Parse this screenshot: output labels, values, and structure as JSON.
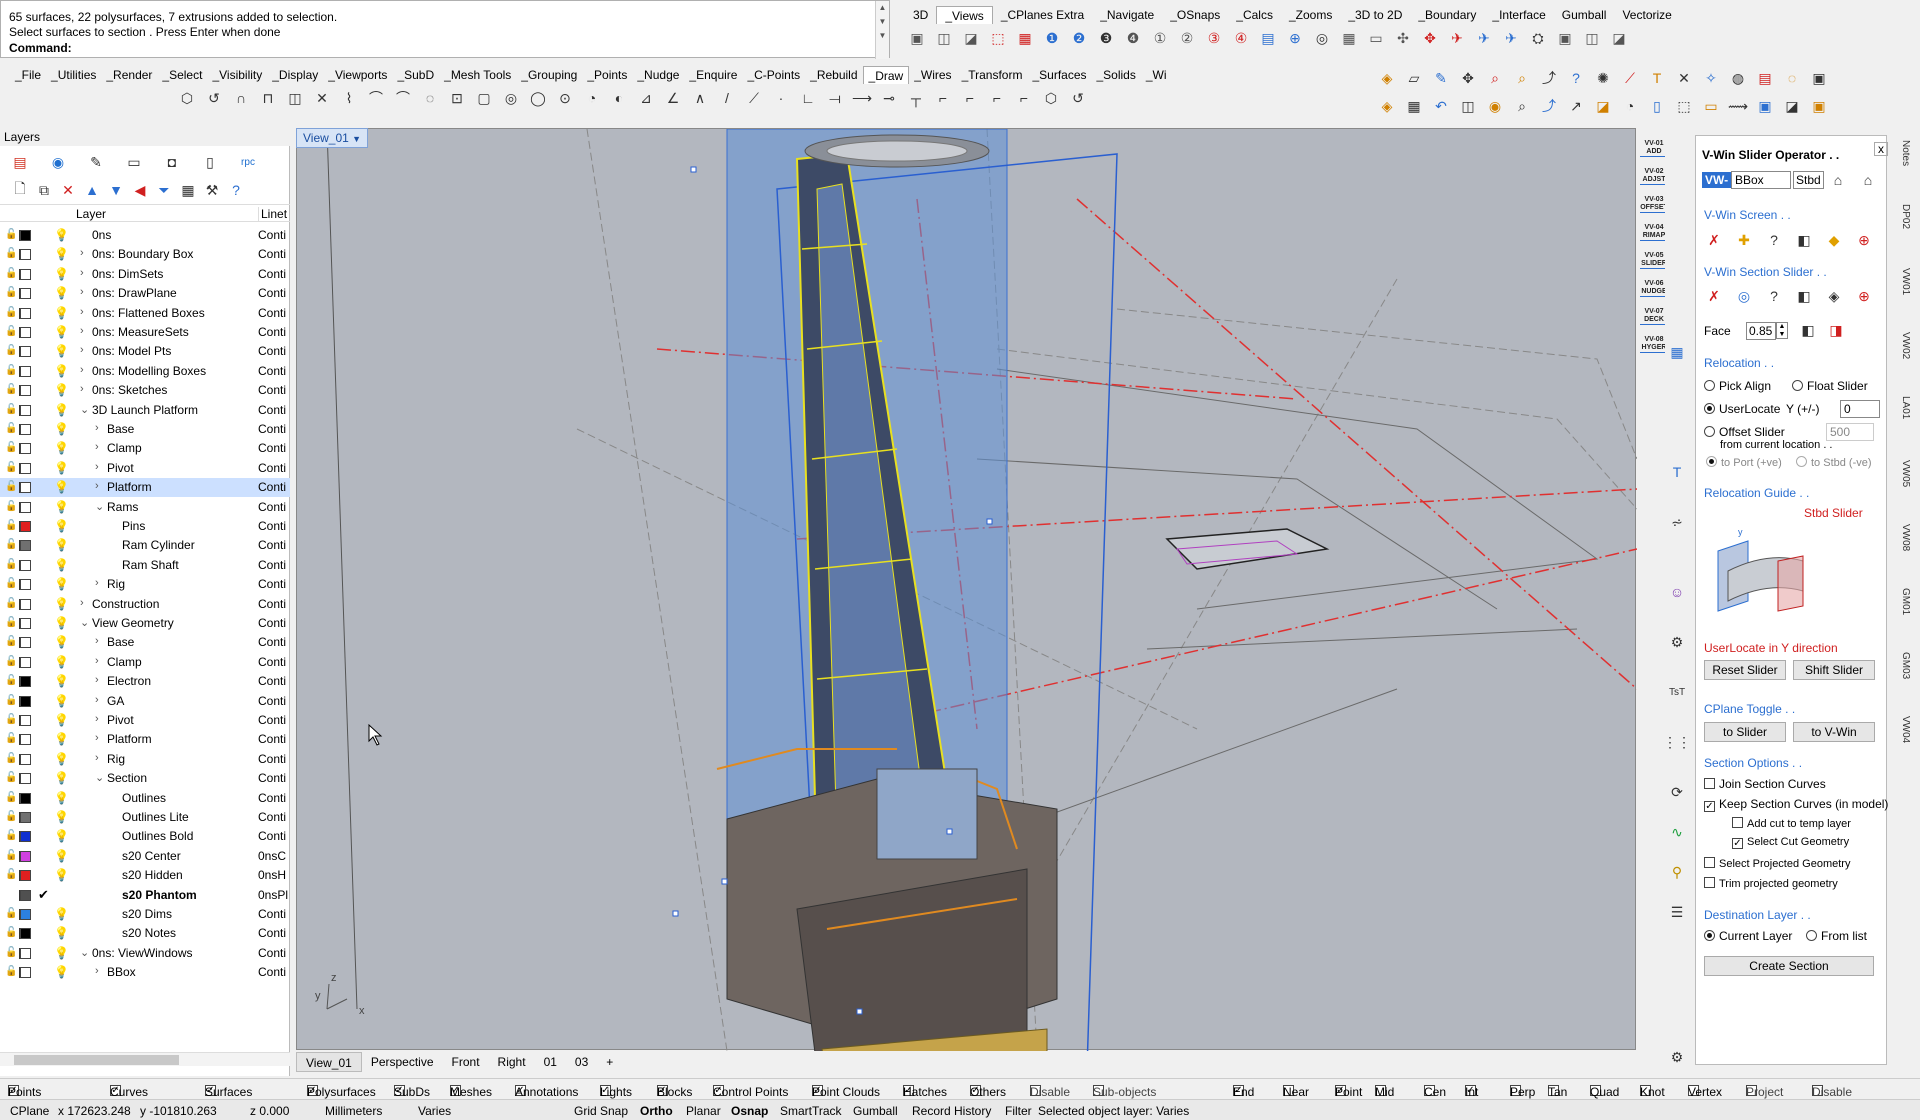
{
  "command": {
    "line1": "65 surfaces, 22 polysurfaces, 7 extrusions added to selection.",
    "line2": "Select surfaces to section . Press Enter when done",
    "prompt": "Command:"
  },
  "top_tabs": [
    "3D",
    "_Views",
    "_CPlanes Extra",
    "_Navigate",
    "_OSnaps",
    "_Calcs",
    "_Zooms",
    "_3D to 2D",
    "_Boundary",
    "_Interface",
    "Gumball",
    "Vectorize"
  ],
  "main_tabs": [
    "_File",
    "_Utilities",
    "_Render",
    "_Select",
    "_Visibility",
    "_Display",
    "_Viewports",
    "_SubD",
    "_Mesh Tools",
    "_Grouping",
    "_Points",
    "_Nudge",
    "_Enquire",
    "_C-Points",
    "_Rebuild",
    "_Draw",
    "_Wires",
    "_Transform",
    "_Surfaces",
    "_Solids",
    "_Wi"
  ],
  "layers_panel": {
    "title": "Layers",
    "col_layer": "Layer",
    "col_linetype": "Linet",
    "rows": [
      {
        "name": "0ns",
        "indent": 0,
        "arrow": "",
        "color": "#000000",
        "lt": "Conti",
        "bulb": "y"
      },
      {
        "name": "0ns: Boundary Box",
        "indent": 0,
        "arrow": ">",
        "color": "#ffffff",
        "lt": "Conti",
        "bulb": "y"
      },
      {
        "name": "0ns: DimSets",
        "indent": 0,
        "arrow": ">",
        "color": "#ffffff",
        "lt": "Conti",
        "bulb": "b"
      },
      {
        "name": "0ns: DrawPlane",
        "indent": 0,
        "arrow": ">",
        "color": "#ffffff",
        "lt": "Conti",
        "bulb": "y"
      },
      {
        "name": "0ns: Flattened Boxes",
        "indent": 0,
        "arrow": ">",
        "color": "#ffffff",
        "lt": "Conti",
        "bulb": "y"
      },
      {
        "name": "0ns: MeasureSets",
        "indent": 0,
        "arrow": ">",
        "color": "#ffffff",
        "lt": "Conti",
        "bulb": "y"
      },
      {
        "name": "0ns: Model Pts",
        "indent": 0,
        "arrow": ">",
        "color": "#ffffff",
        "lt": "Conti",
        "bulb": "y"
      },
      {
        "name": "0ns: Modelling Boxes",
        "indent": 0,
        "arrow": ">",
        "color": "#ffffff",
        "lt": "Conti",
        "bulb": "b"
      },
      {
        "name": "0ns: Sketches",
        "indent": 0,
        "arrow": ">",
        "color": "#ffffff",
        "lt": "Conti",
        "bulb": "y"
      },
      {
        "name": "3D Launch Platform",
        "indent": 0,
        "arrow": "v",
        "color": "#ffffff",
        "lt": "Conti",
        "bulb": "y"
      },
      {
        "name": "Base",
        "indent": 1,
        "arrow": ">",
        "color": "#ffffff",
        "lt": "Conti",
        "bulb": "y"
      },
      {
        "name": "Clamp",
        "indent": 1,
        "arrow": ">",
        "color": "#ffffff",
        "lt": "Conti",
        "bulb": "y"
      },
      {
        "name": "Pivot",
        "indent": 1,
        "arrow": ">",
        "color": "#ffffff",
        "lt": "Conti",
        "bulb": "y"
      },
      {
        "name": "Platform",
        "indent": 1,
        "arrow": ">",
        "color": "#ffffff",
        "lt": "Conti",
        "bulb": "y",
        "sel": true
      },
      {
        "name": "Rams",
        "indent": 1,
        "arrow": "v",
        "color": "#ffffff",
        "lt": "Conti",
        "bulb": "y"
      },
      {
        "name": "Pins",
        "indent": 2,
        "arrow": "",
        "color": "#e02020",
        "lt": "Conti",
        "bulb": "y"
      },
      {
        "name": "Ram Cylinder",
        "indent": 2,
        "arrow": "",
        "color": "#707070",
        "lt": "Conti",
        "bulb": "y"
      },
      {
        "name": "Ram Shaft",
        "indent": 2,
        "arrow": "",
        "color": "#ffffff",
        "lt": "Conti",
        "bulb": "y"
      },
      {
        "name": "Rig",
        "indent": 1,
        "arrow": ">",
        "color": "#ffffff",
        "lt": "Conti",
        "bulb": "y"
      },
      {
        "name": "Construction",
        "indent": 0,
        "arrow": ">",
        "color": "#ffffff",
        "lt": "Conti",
        "bulb": "y"
      },
      {
        "name": "View Geometry",
        "indent": 0,
        "arrow": "v",
        "color": "#ffffff",
        "lt": "Conti",
        "bulb": "y"
      },
      {
        "name": "Base",
        "indent": 1,
        "arrow": ">",
        "color": "#ffffff",
        "lt": "Conti",
        "bulb": "b"
      },
      {
        "name": "Clamp",
        "indent": 1,
        "arrow": ">",
        "color": "#ffffff",
        "lt": "Conti",
        "bulb": "b"
      },
      {
        "name": "Electron",
        "indent": 1,
        "arrow": ">",
        "color": "#000000",
        "lt": "Conti",
        "bulb": "b"
      },
      {
        "name": "GA",
        "indent": 1,
        "arrow": ">",
        "color": "#000000",
        "lt": "Conti",
        "bulb": "b"
      },
      {
        "name": "Pivot",
        "indent": 1,
        "arrow": ">",
        "color": "#ffffff",
        "lt": "Conti",
        "bulb": "b"
      },
      {
        "name": "Platform",
        "indent": 1,
        "arrow": ">",
        "color": "#ffffff",
        "lt": "Conti",
        "bulb": "b"
      },
      {
        "name": "Rig",
        "indent": 1,
        "arrow": ">",
        "color": "#ffffff",
        "lt": "Conti",
        "bulb": "b"
      },
      {
        "name": "Section",
        "indent": 1,
        "arrow": "v",
        "color": "#ffffff",
        "lt": "Conti",
        "bulb": "y"
      },
      {
        "name": "Outlines",
        "indent": 2,
        "arrow": "",
        "color": "#000000",
        "lt": "Conti",
        "bulb": "y"
      },
      {
        "name": "Outlines Lite",
        "indent": 2,
        "arrow": "",
        "color": "#707070",
        "lt": "Conti",
        "bulb": "y"
      },
      {
        "name": "Outlines Bold",
        "indent": 2,
        "arrow": "",
        "color": "#1030d0",
        "lt": "Conti",
        "bulb": "y"
      },
      {
        "name": "s20 Center",
        "indent": 2,
        "arrow": "",
        "color": "#d040e0",
        "lt": "0nsC",
        "bulb": "y"
      },
      {
        "name": "s20 Hidden",
        "indent": 2,
        "arrow": "",
        "color": "#e02020",
        "lt": "0nsH",
        "bulb": "y"
      },
      {
        "name": "s20 Phantom",
        "indent": 2,
        "arrow": "",
        "color": "#505050",
        "lt": "0nsPl",
        "bulb": "",
        "bold": true,
        "check": true
      },
      {
        "name": "s20 Dims",
        "indent": 2,
        "arrow": "",
        "color": "#2c80e0",
        "lt": "Conti",
        "bulb": "y"
      },
      {
        "name": "s20 Notes",
        "indent": 2,
        "arrow": "",
        "color": "#000000",
        "lt": "Conti",
        "bulb": "y"
      },
      {
        "name": "0ns: ViewWindows",
        "indent": 0,
        "arrow": "v",
        "color": "#ffffff",
        "lt": "Conti",
        "bulb": "y"
      },
      {
        "name": "BBox",
        "indent": 1,
        "arrow": ">",
        "color": "#ffffff",
        "lt": "Conti",
        "bulb": "y"
      }
    ]
  },
  "viewport": {
    "active_tab": "View_01",
    "tabs": [
      "View_01",
      "Perspective",
      "Front",
      "Right",
      "01",
      "03",
      "+"
    ],
    "axis_x": "x",
    "axis_y": "y",
    "axis_z": "z"
  },
  "left_tool_labels": [
    "VV-01 ADD",
    "VV-02 ADJST",
    "VV-03 OFFSET",
    "VV-04 RIMAP",
    "VV-05 SLIDER",
    "VV-06 NUDGE",
    "VV-07 DECK",
    "VV-08 HYGER"
  ],
  "right_panel": {
    "title": "V-Win Slider Operator . .",
    "close": "x",
    "vw_label": "VW-",
    "bbox_value": "BBox",
    "stbd": "Stbd",
    "screen_header": "V-Win Screen . .",
    "section_slider_header": "V-Win Section Slider . .",
    "face_label": "Face",
    "face_value": "0.85",
    "relocation_header": "Relocation . .",
    "pick_align": "Pick Align",
    "float_slider": "Float Slider",
    "user_locate": "UserLocate",
    "y_label": "Y (+/-)",
    "y_value": "0",
    "offset_slider": "Offset Slider",
    "offset_value": "500",
    "from_current": "from current location . .",
    "to_port": "to Port (+ve)",
    "to_stbd": "to Stbd (-ve)",
    "guide_header": "Relocation Guide . .",
    "stbd_slider": "Stbd Slider",
    "guide_note": "UserLocate in Y direction",
    "reset_slider": "Reset Slider",
    "shift_slider": "Shift Slider",
    "cplane_header": "CPlane Toggle . .",
    "to_slider": "to Slider",
    "to_vwin": "to V-Win",
    "options_header": "Section Options . .",
    "join_curves": "Join Section Curves",
    "keep_curves": "Keep Section Curves (in model)",
    "add_cut": "Add cut to temp layer",
    "select_cut": "Select Cut Geometry",
    "select_projected": "Select Projected Geometry",
    "trim_projected": "Trim projected geometry",
    "dest_header": "Destination Layer . .",
    "current_layer": "Current Layer",
    "from_list": "From list",
    "create_section": "Create Section"
  },
  "side_tabs": [
    "Notes",
    "DP02",
    "VW01",
    "VW02",
    "LA01",
    "VW05",
    "VW08",
    "GM01",
    "GM03",
    "VW04"
  ],
  "filter_bar": {
    "points": "Points",
    "curves": "Curves",
    "surfaces": "Surfaces",
    "polysurfaces": "Polysurfaces",
    "subds": "SubDs",
    "meshes": "Meshes",
    "annotations": "Annotations",
    "lights": "Lights",
    "blocks": "Blocks",
    "control_points": "Control Points",
    "point_clouds": "Point Clouds",
    "hatches": "Hatches",
    "others": "Others",
    "disable": "Disable",
    "sub_objects": "Sub-objects",
    "end": "End",
    "near": "Near",
    "point": "Point",
    "mid": "Mid",
    "cen": "Cen",
    "int": "Int",
    "perp": "Perp",
    "tan": "Tan",
    "quad": "Quad",
    "knot": "Knot",
    "vertex": "Vertex",
    "project": "Project",
    "disable2": "Disable"
  },
  "status_bar": {
    "cplane": "CPlane",
    "x": "x 172623.248",
    "y": "y -101810.263",
    "z": "z 0.000",
    "units": "Millimeters",
    "varies": "Varies",
    "grid_snap": "Grid Snap",
    "ortho": "Ortho",
    "planar": "Planar",
    "osnap": "Osnap",
    "smarttrack": "SmartTrack",
    "gumball": "Gumball",
    "record_history": "Record History",
    "filter": "Filter",
    "message": "Selected object layer: Varies"
  }
}
